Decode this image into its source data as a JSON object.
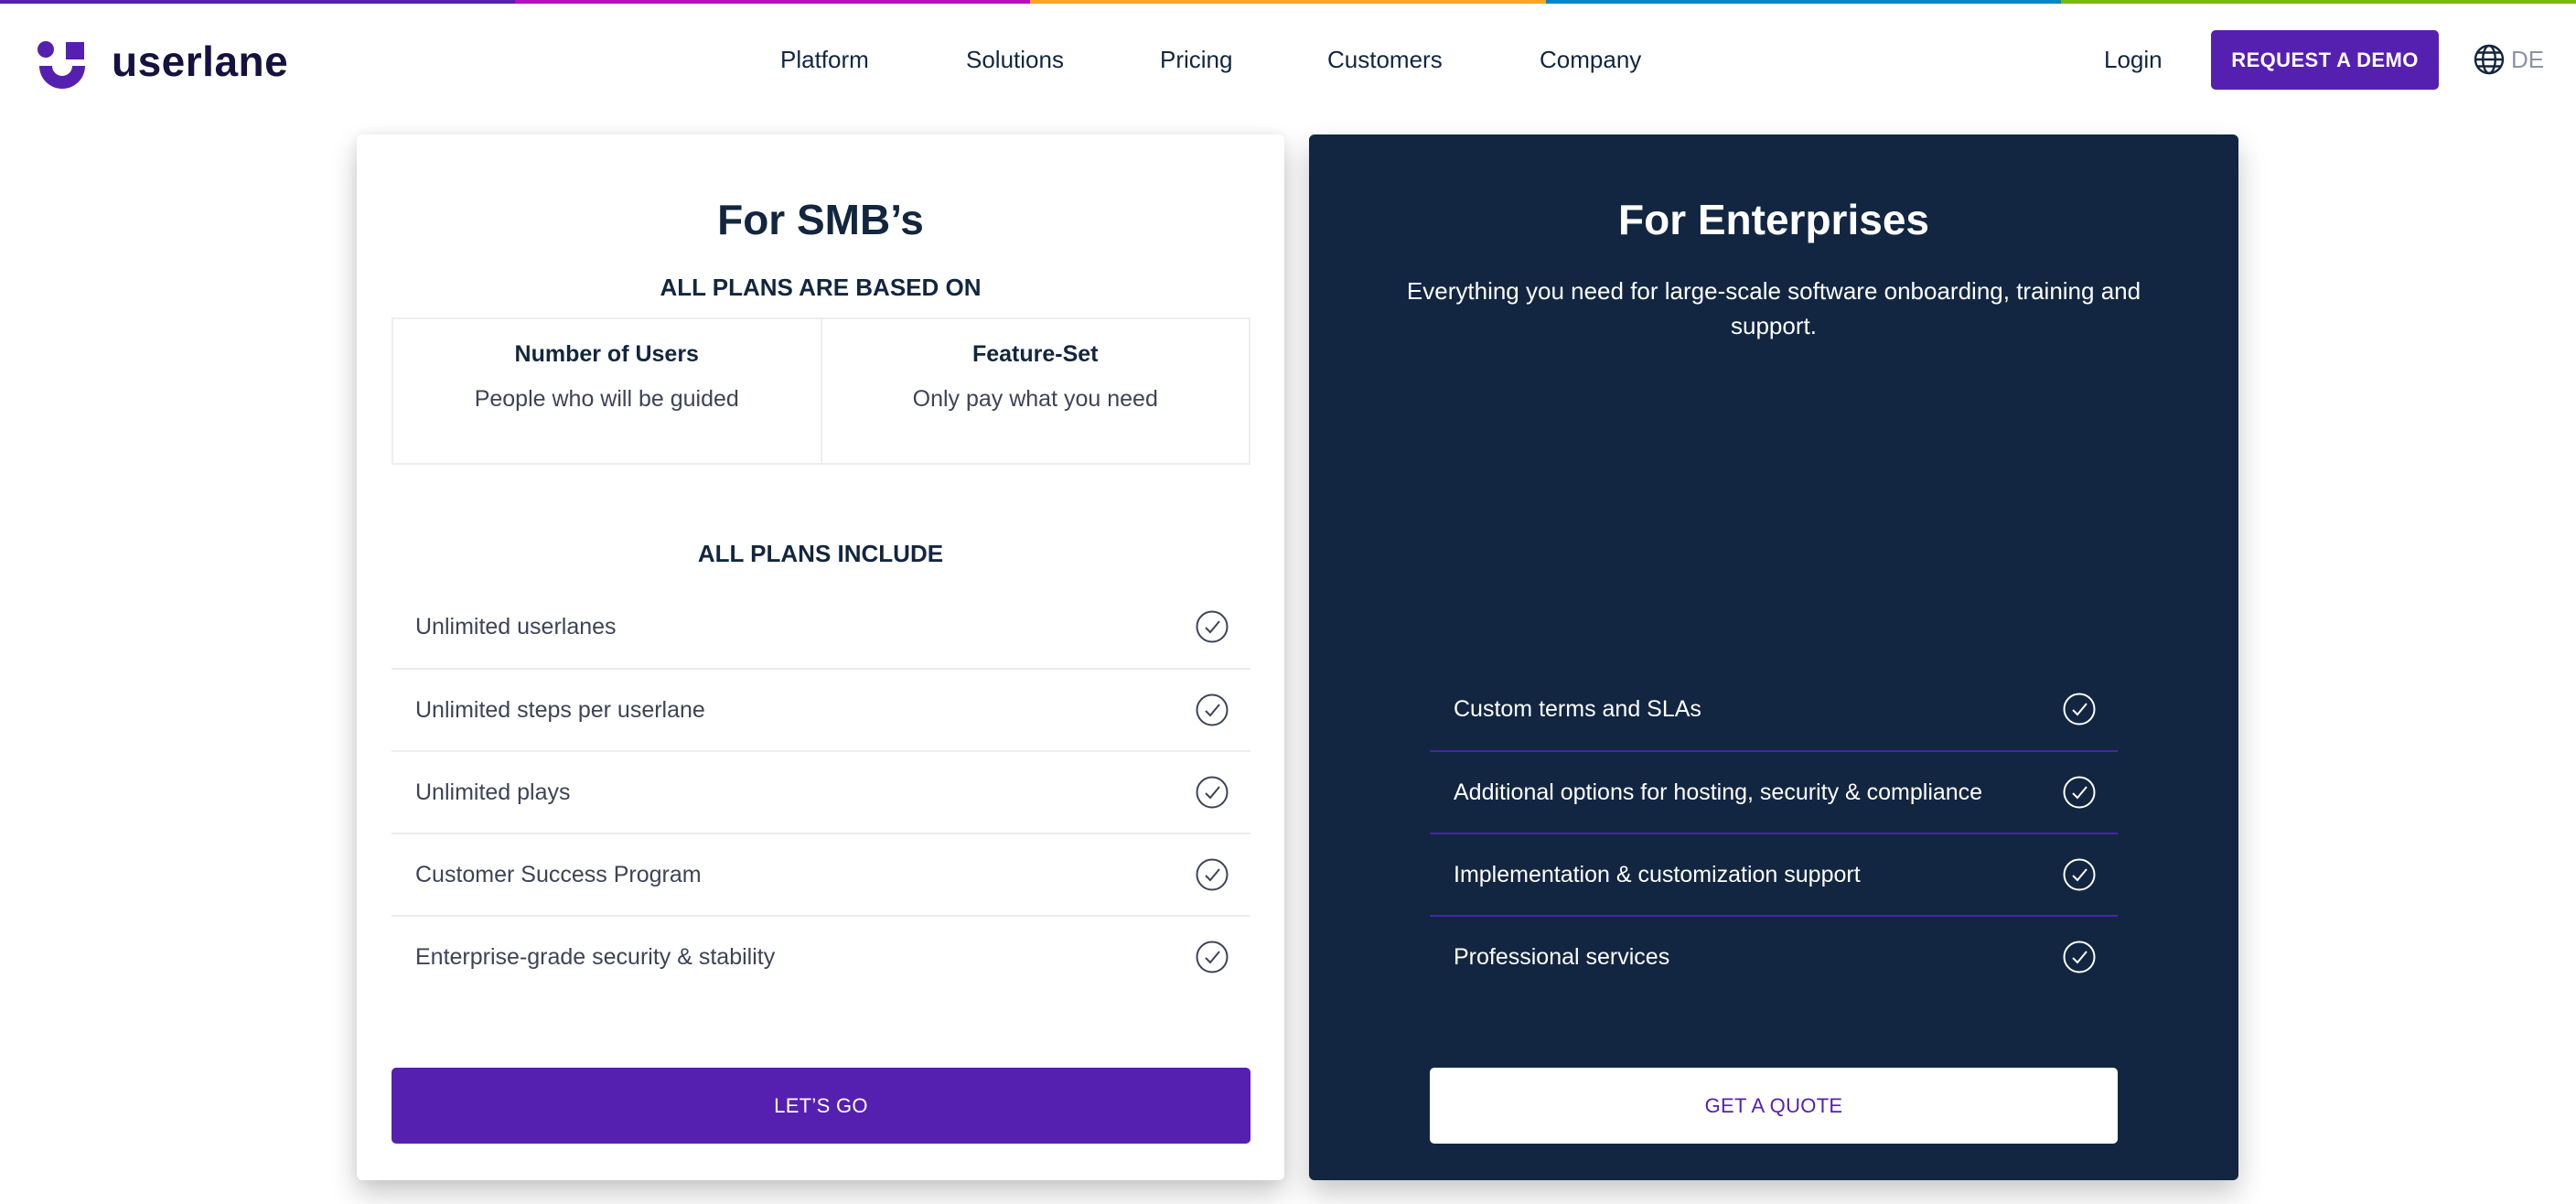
{
  "brand": {
    "name": "userlane",
    "accent": "#5520b0",
    "navy": "#122642",
    "top_bar_colors": [
      "#5520b0",
      "#b80fbe",
      "#f8a51f",
      "#0088c9",
      "#7bb80e"
    ]
  },
  "nav": {
    "items": [
      {
        "label": "Platform"
      },
      {
        "label": "Solutions"
      },
      {
        "label": "Pricing"
      },
      {
        "label": "Customers"
      },
      {
        "label": "Company"
      }
    ],
    "login_label": "Login",
    "demo_label": "REQUEST A DEMO",
    "language": "DE",
    "language_icon": "globe-icon"
  },
  "smb": {
    "title": "For SMB’s",
    "based_on_heading": "ALL PLANS ARE BASED ON",
    "based_on": [
      {
        "title": "Number of Users",
        "subtitle": "People who will be guided"
      },
      {
        "title": "Feature-Set",
        "subtitle": "Only pay what you need"
      }
    ],
    "include_heading": "ALL PLANS INCLUDE",
    "features": [
      {
        "label": "Unlimited userlanes",
        "icon": "check-circle-icon"
      },
      {
        "label": "Unlimited steps per userlane",
        "icon": "check-circle-icon"
      },
      {
        "label": "Unlimited plays",
        "icon": "check-circle-icon"
      },
      {
        "label": "Customer Success Program",
        "icon": "check-circle-icon"
      },
      {
        "label": "Enterprise-grade security & stability",
        "icon": "check-circle-icon"
      }
    ],
    "cta_label": "LET’S GO"
  },
  "enterprise": {
    "title": "For Enterprises",
    "description": "Everything you need for large-scale software onboarding, training and support.",
    "features": [
      {
        "label": "Custom terms and SLAs",
        "icon": "check-circle-icon"
      },
      {
        "label": "Additional options for hosting, security & compliance",
        "icon": "check-circle-icon"
      },
      {
        "label": "Implementation & customization support",
        "icon": "check-circle-icon"
      },
      {
        "label": "Professional services",
        "icon": "check-circle-icon"
      }
    ],
    "cta_label": "GET A QUOTE"
  }
}
